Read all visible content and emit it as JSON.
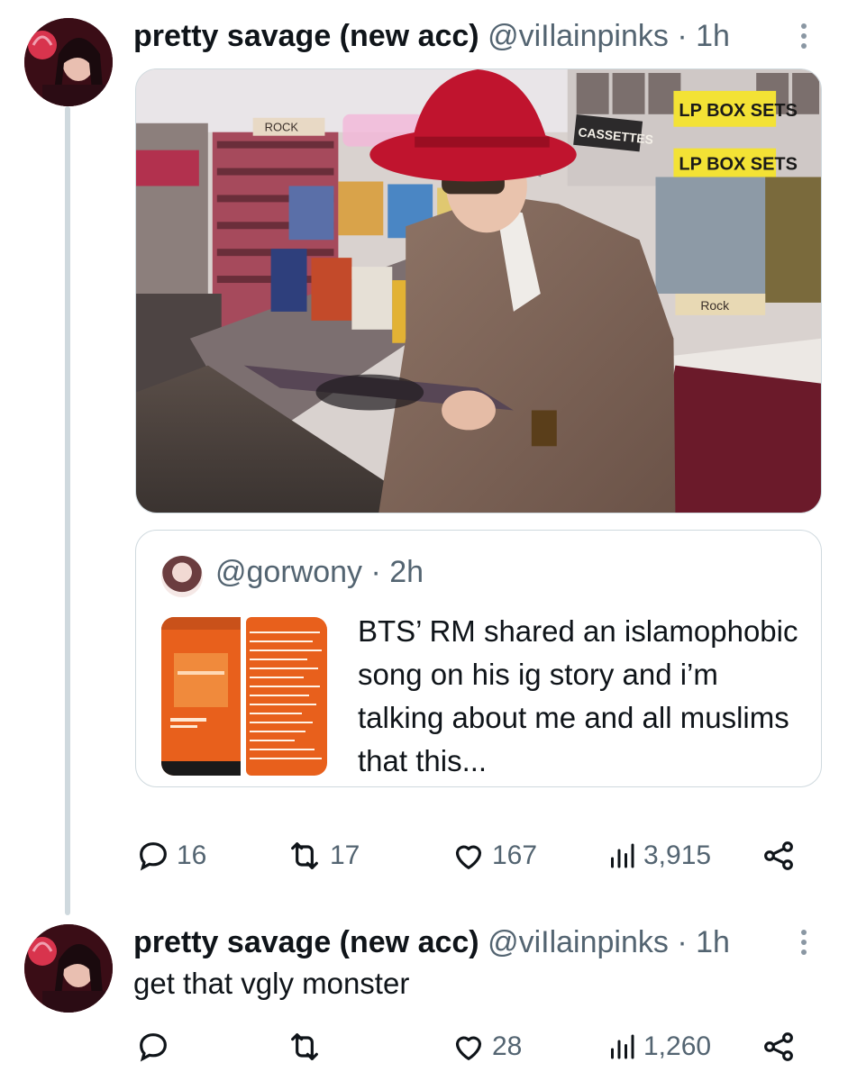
{
  "tweet1": {
    "name": "pretty savage (new acc)",
    "handle": "@viIlainpinks",
    "separator": "·",
    "time": "1h",
    "image_alt": "man in red hat and tweed suit browsing vinyl records in a record store",
    "store_signs": {
      "rock1": "ROCK",
      "lp1": "LP BOX SETS",
      "lp2": "LP BOX SETS",
      "cassettes": "CASSETTES",
      "rock2": "Rock"
    },
    "quote": {
      "handle": "@gorwony",
      "separator": "·",
      "time": "2h",
      "text": "BTS’ RM shared an islamophobic song on his ig story and i’m talking about me and all muslims that this..."
    },
    "stats": {
      "replies": "16",
      "retweets": "17",
      "likes": "167",
      "views": "3,915"
    }
  },
  "tweet2": {
    "name": "pretty savage (new acc)",
    "handle": "@viIlainpinks",
    "separator": "·",
    "time": "1h",
    "text": "get that vgly monster",
    "stats": {
      "replies": "",
      "retweets": "",
      "likes": "28",
      "views": "1,260"
    }
  },
  "colors": {
    "text": "#0f1419",
    "muted": "#536471",
    "border": "#cfd9de",
    "hat": "#c0142e",
    "orange": "#e8601c"
  },
  "icons": [
    "more-icon",
    "reply-icon",
    "retweet-icon",
    "like-icon",
    "views-icon",
    "share-icon"
  ]
}
